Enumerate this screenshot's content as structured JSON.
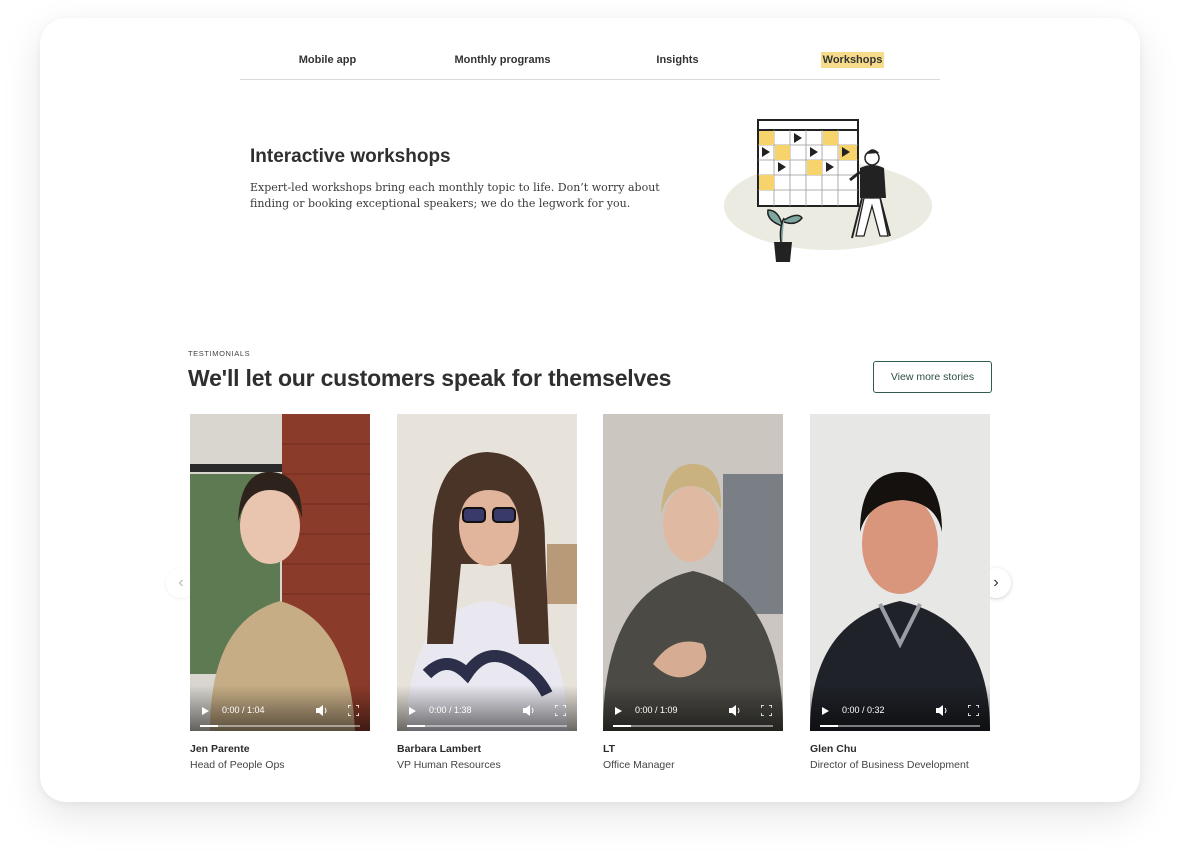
{
  "tabs": [
    {
      "label": "Mobile app",
      "active": false
    },
    {
      "label": "Monthly programs",
      "active": false
    },
    {
      "label": "Insights",
      "active": false
    },
    {
      "label": "Workshops",
      "active": true
    }
  ],
  "feature": {
    "title": "Interactive workshops",
    "description": "Expert-led workshops bring each monthly topic to life. Don’t worry about finding or booking exceptional speakers; we do the legwork for you."
  },
  "testimonials": {
    "eyebrow": "TESTIMONIALS",
    "title": "We'll let our customers speak for themselves",
    "more_button": "View more stories",
    "items": [
      {
        "name": "Jen Parente",
        "role": "Head of People Ops",
        "time": "0:00 / 1:04"
      },
      {
        "name": "Barbara Lambert",
        "role": "VP Human Resources",
        "time": "0:00 / 1:38"
      },
      {
        "name": "LT",
        "role": "Office Manager",
        "time": "0:00 / 1:09"
      },
      {
        "name": "Glen Chu",
        "role": "Director of Business Development",
        "time": "0:00 / 0:32"
      }
    ]
  },
  "icons": {
    "prev": "chevron-left-icon",
    "next": "chevron-right-icon",
    "play": "play-icon",
    "volume": "volume-icon",
    "fullscreen": "fullscreen-icon"
  },
  "colors": {
    "active_tab_highlight": "#f6dc8a",
    "button_border": "#2f5d52"
  }
}
